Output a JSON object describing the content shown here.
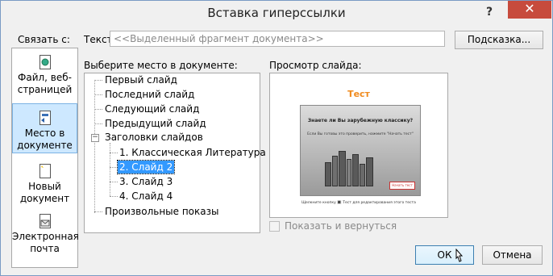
{
  "window": {
    "title": "Вставка гиперссылки",
    "help": "?",
    "close": "✕"
  },
  "link_to": {
    "label": "Связать с:",
    "items": [
      {
        "label": "Файл, веб-страницей",
        "icon": "web-file-icon"
      },
      {
        "label": "Место в документе",
        "icon": "document-place-icon",
        "selected": true
      },
      {
        "label": "Новый документ",
        "icon": "new-document-icon"
      },
      {
        "label": "Электронная почта",
        "icon": "email-icon"
      }
    ]
  },
  "text": {
    "label": "Текст:",
    "value": "<<Выделенный фрагмент документа>>"
  },
  "hint_button": "Подсказка...",
  "select_place": {
    "label": "Выберите место в документе:",
    "items": [
      "Первый слайд",
      "Последний слайд",
      "Следующий слайд",
      "Предыдущий слайд",
      "Заголовки слайдов",
      "1.  Классическая Литература",
      "2. Слайд 2",
      "3. Слайд 3",
      "4. Слайд 4",
      "Произвольные показы"
    ],
    "selected_index": 6
  },
  "preview": {
    "label": "Просмотр слайда:",
    "slide_title": "Тест",
    "slide_question": "Знаете ли Вы зарубежную классику?",
    "slide_subtext": "Если Вы готовы это проверить, нажмите \"Начать тест\"",
    "slide_button": "Начать тест",
    "slide_footer": "Щелкните кнопку 🔳 Тест для редактирования этого теста"
  },
  "show_and_return": "Показать и вернуться",
  "buttons": {
    "ok": "ОК",
    "cancel": "Отмена"
  },
  "colors": {
    "selection": "#3399ff",
    "close": "#c74b3d",
    "slide_title": "#f08a1c"
  }
}
